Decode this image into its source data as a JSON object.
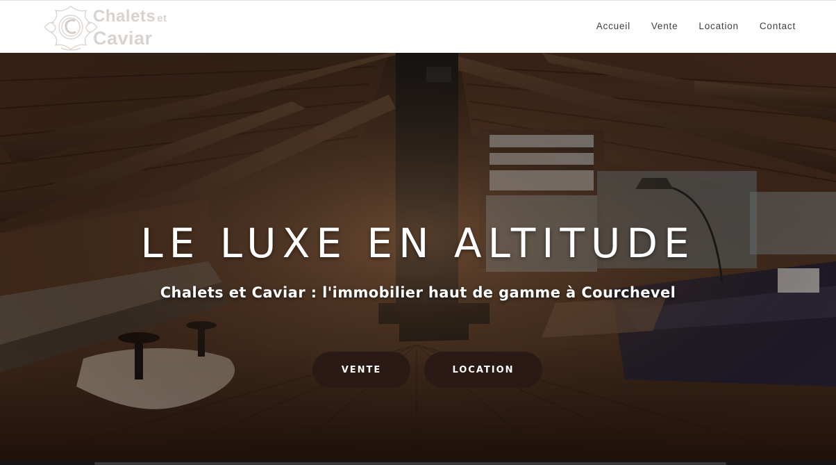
{
  "brand": {
    "logo_line1": "Chalets",
    "logo_line1_suffix": "et",
    "logo_line2": "Caviar"
  },
  "nav": {
    "items": [
      {
        "label": "Accueil"
      },
      {
        "label": "Vente"
      },
      {
        "label": "Location"
      },
      {
        "label": "Contact"
      }
    ]
  },
  "hero": {
    "title": "LE LUXE EN ALTITUDE",
    "subtitle": "Chalets et Caviar : l'immobilier haut de gamme à Courchevel",
    "buttons": {
      "vente": "VENTE",
      "location": "LOCATION"
    }
  },
  "colors": {
    "button_bg": "#2b1915",
    "nav_text": "#3e3e3e",
    "logo": "#d8d3cf"
  },
  "icons": {
    "logo_emblem": "chalets-et-caviar-crest-icon"
  }
}
